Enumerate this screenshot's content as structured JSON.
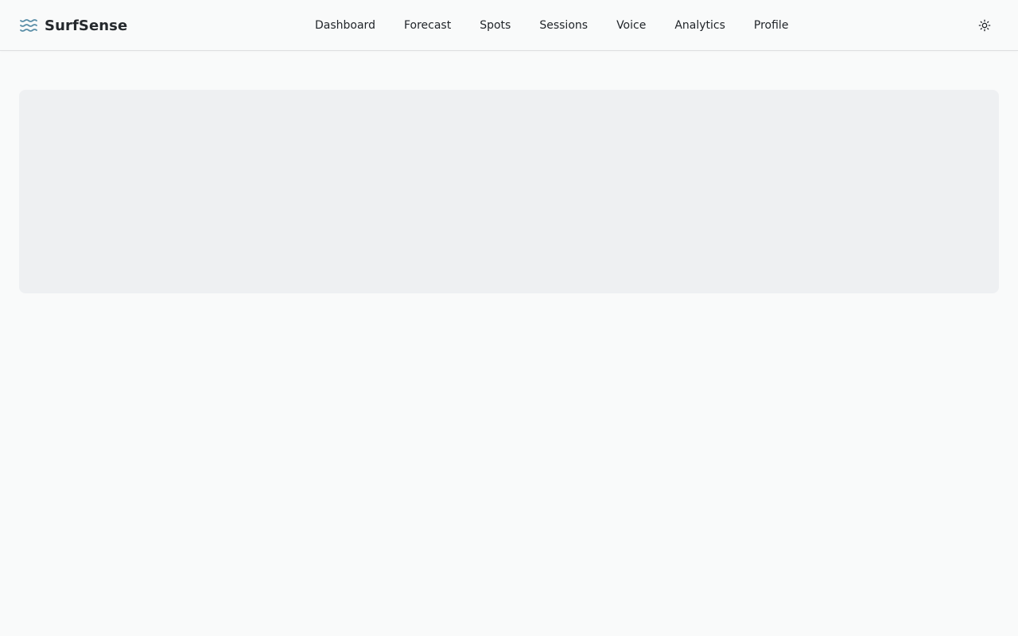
{
  "app": {
    "name": "SurfSense",
    "logo_icon": "waves-icon"
  },
  "nav": {
    "items": [
      {
        "label": "Dashboard"
      },
      {
        "label": "Forecast"
      },
      {
        "label": "Spots"
      },
      {
        "label": "Sessions"
      },
      {
        "label": "Voice"
      },
      {
        "label": "Analytics"
      },
      {
        "label": "Profile"
      }
    ]
  },
  "header": {
    "theme_toggle_icon": "sun-icon"
  },
  "main": {
    "loading_placeholder": "skeleton"
  },
  "colors": {
    "background": "#f9fafa",
    "logo_accent": "#5b8fa8",
    "skeleton": "#eef0f2",
    "text": "#1f2328"
  }
}
